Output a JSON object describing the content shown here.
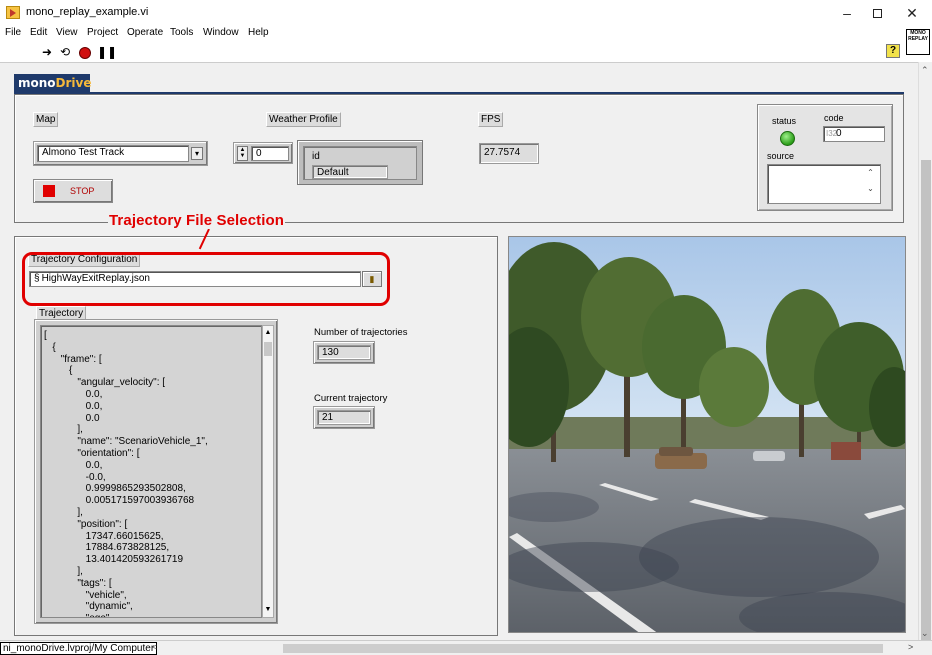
{
  "window": {
    "title": "mono_replay_example.vi",
    "minimize_icon": "minimize-icon",
    "maximize_icon": "maximize-icon",
    "close_icon": "close-icon"
  },
  "menu": [
    "File",
    "Edit",
    "View",
    "Project",
    "Operate",
    "Tools",
    "Window",
    "Help"
  ],
  "toolbar": {
    "icons": [
      "run-arrow-icon",
      "run-continuously-icon",
      "abort-icon",
      "pause-icon"
    ],
    "help_label": "?",
    "vi_icon_text": "MONO REPLAY"
  },
  "brand": {
    "mono": "mono",
    "drive": "Drive"
  },
  "controls": {
    "map_label": "Map",
    "map_value": "Almono Test Track",
    "stop_label": "STOP",
    "weather_label": "Weather Profile",
    "weather_index": "0",
    "weather_id_label": "id",
    "weather_value": "Default",
    "fps_label": "FPS",
    "fps_value": "27.7574",
    "status_label": "status",
    "code_label": "code",
    "code_value": "0",
    "source_label": "source",
    "source_value": ""
  },
  "annotation": {
    "callout": "Trajectory File Selection"
  },
  "trajectory": {
    "config_label": "Trajectory Configuration",
    "file_path": "HighWayExitReplay.json",
    "text_label": "Trajectory",
    "text": "[\n   {\n      \"frame\": [\n         {\n            \"angular_velocity\": [\n               0.0,\n               0.0,\n               0.0\n            ],\n            \"name\": \"ScenarioVehicle_1\",\n            \"orientation\": [\n               0.0,\n               -0.0,\n               0.9999865293502808,\n               0.005171597003936768\n            ],\n            \"position\": [\n               17347.66015625,\n               17884.673828125,\n               13.401420593261719\n            ],\n            \"tags\": [\n               \"vehicle\",\n               \"dynamic\",\n               \"ego\"",
    "num_label": "Number of trajectories",
    "num_value": "130",
    "current_label": "Current trajectory",
    "current_value": "21"
  },
  "statusbar": {
    "project_path": "ni_monoDrive.lvproj/My Computer"
  },
  "colors": {
    "brand_blue": "#1f3a6b",
    "brand_orange": "#f5b93b",
    "callout_red": "#e00000",
    "status_green": "#2a9d18"
  }
}
